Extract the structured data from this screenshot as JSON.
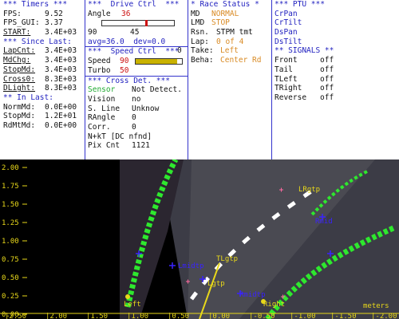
{
  "timers": {
    "header": "*** Timers ***",
    "fps_label": "FPS:",
    "fps_value": "9.52",
    "fpsgui_label": "FPS_GUI:",
    "fpsgui_value": "3.37",
    "start_label": "START:",
    "start_value": "3.4E+03",
    "since_header": "*** Since Last:",
    "lapcnt_label": "LapCnt:",
    "lapcnt_value": "3.4E+03",
    "mdchg_label": "MdChg:",
    "mdchg_value": "3.4E+03",
    "stopmd_label": "StopMd:",
    "stopmd_value": "3.4E+03",
    "cross0_label": "Cross0:",
    "cross0_value": "8.3E+03",
    "dlight_label": "DLight:",
    "dlight_value": "8.3E+03",
    "inlast_header": "** In Last:",
    "normmd_label": "NormMd:",
    "normmd_value": "0.0E+00",
    "stopmd2_label": "StopMd:",
    "stopmd2_value": "1.2E+01",
    "rdmtmd_label": "RdMtMd:",
    "rdmtmd_value": "0.0E+00"
  },
  "drive": {
    "header": "***  Drive Ctrl  ***",
    "angle_label": "Angle",
    "angle_value": "36",
    "scale_left": "90",
    "scale_right": "0",
    "scale_mid": "45",
    "avg_text": "avg=36.0  dev=0.0",
    "speed_header": "***  Speed Ctrl  ***",
    "speed_label": "Speed",
    "speed_value": "90",
    "speed_fraction": 0.9,
    "turbo_label": "Turbo",
    "turbo_value": "50",
    "cross_header": "*** Cross Det. ***",
    "sensor_label": "Sensor",
    "sensor_value": "Not Detect.",
    "vision_label": "Vision",
    "vision_value": "no",
    "sline_label": "S. Line",
    "sline_value": "Unknow",
    "rangle_label": "RAngle",
    "rangle_value": "0",
    "corr_label": "Corr.",
    "corr_value": "0",
    "nkt_text": "N+kT [DC nfnd]",
    "pix_label": "Pix Cnt",
    "pix_value": "1121"
  },
  "race": {
    "header": "* Race Status *",
    "md_label": "MD",
    "md_value": "NORMAL",
    "lmd_label": "LMD",
    "lmd_value": "STOP",
    "rsn_label": "Rsn.",
    "rsn_value": "STPM tmt",
    "lap_label": "Lap:",
    "lap_value": "0 of 4",
    "take_label": "Take:",
    "take_value": "Left",
    "beha_label": "Beha:",
    "beha_value": "Center Rd"
  },
  "ptu": {
    "header": "*** PTU ***",
    "items": [
      "CrPan",
      "CrTilt",
      "DsPan",
      "DsTilt"
    ],
    "signals_header": "** SIGNALS **",
    "signals": [
      {
        "label": "Front",
        "value": "off"
      },
      {
        "label": "Tail",
        "value": "off"
      },
      {
        "label": "TLeft",
        "value": "off"
      },
      {
        "label": "TRight",
        "value": "off"
      },
      {
        "label": "Reverse",
        "value": "off"
      }
    ]
  },
  "camera": {
    "y_ticks": [
      "2.00",
      "1.75",
      "1.50",
      "1.25",
      "1.00",
      "0.75",
      "0.50",
      "0.25",
      "0.00"
    ],
    "x_ticks": [
      "2.50",
      "2.00",
      "1.50",
      "1.00",
      "0.50",
      "0.00",
      "-0.50",
      "-1.00",
      "-1.50",
      "-2.00"
    ],
    "unit": "meters",
    "labels": {
      "left": "Left",
      "right": "Right",
      "lrgtp": "LRgtp",
      "tlgtp": "TLgtp",
      "lmidtp": "Lmidtp",
      "lgtp": "Lgtp",
      "rmidtp": "Rmidtp",
      "rmid": "Rmid"
    },
    "colors": {
      "lane": "#2ee82e",
      "track": "#3a3a44",
      "marker": "#3a22ff",
      "label": "#e8d81a"
    }
  }
}
